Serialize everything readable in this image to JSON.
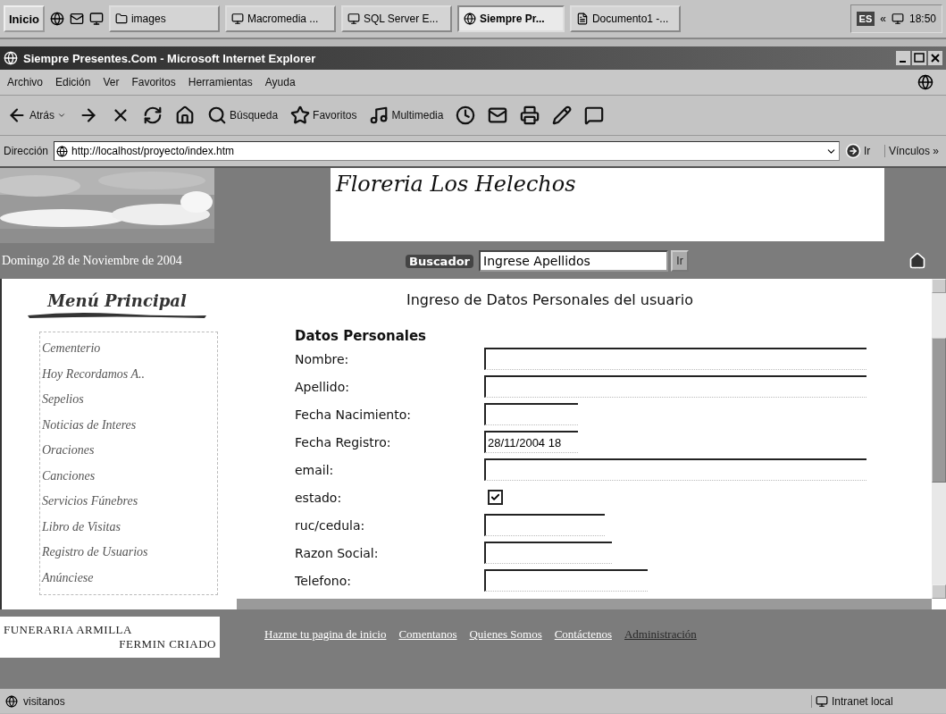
{
  "taskbar": {
    "start": "Inicio",
    "buttons": [
      {
        "label": "images",
        "kind": "folder",
        "selected": false
      },
      {
        "label": "Macromedia ...",
        "kind": "app",
        "selected": false
      },
      {
        "label": "SQL Server E...",
        "kind": "app",
        "selected": false
      },
      {
        "label": "Siempre Pr...",
        "kind": "browser",
        "selected": true
      },
      {
        "label": "Documento1 -...",
        "kind": "doc",
        "selected": false
      }
    ],
    "language": "ES",
    "tray_toggle": "«",
    "clock": "18:50"
  },
  "window": {
    "title": "Siempre Presentes.Com - Microsoft Internet Explorer"
  },
  "menu": [
    "Archivo",
    "Edición",
    "Ver",
    "Favoritos",
    "Herramientas",
    "Ayuda"
  ],
  "toolbar": [
    {
      "kind": "back",
      "label": "Atrás"
    },
    {
      "kind": "forward"
    },
    {
      "kind": "stop"
    },
    {
      "kind": "refresh"
    },
    {
      "kind": "home"
    },
    {
      "kind": "search",
      "label": "Búsqueda"
    },
    {
      "kind": "favorites",
      "label": "Favoritos"
    },
    {
      "kind": "media",
      "label": "Multimedia"
    },
    {
      "kind": "history"
    },
    {
      "kind": "mail"
    },
    {
      "kind": "print"
    },
    {
      "kind": "edit"
    },
    {
      "kind": "discuss"
    }
  ],
  "address": {
    "label": "Dirección",
    "url": "http://localhost/proyecto/index.htm",
    "go": "Ir",
    "links": "Vínculos »"
  },
  "banner": {
    "site_title": "Floreria Los Helechos",
    "date": "Domingo 28 de Noviembre de 2004",
    "search_label": "Buscador",
    "search_value": "Ingrese Apellidos",
    "search_button": "Ir"
  },
  "sidebar": {
    "heading": "Menú Principal",
    "items": [
      "Cementerio",
      "Hoy Recordamos A..",
      "Sepelios",
      "Noticias de Interes",
      "Oraciones",
      "Canciones",
      "Servicios Fúnebres",
      "Libro de Visitas",
      "Registro de Usuarios",
      "Anúnciese"
    ]
  },
  "form": {
    "title": "Ingreso de Datos Personales del usuario",
    "section": "Datos Personales",
    "fields": [
      {
        "label": "Nombre:",
        "kind": "text"
      },
      {
        "label": "Apellido:",
        "kind": "text"
      },
      {
        "label": "Fecha Nacimiento:",
        "kind": "text"
      },
      {
        "label": "Fecha Registro:",
        "kind": "text",
        "value": "28/11/2004 18"
      },
      {
        "label": "email:",
        "kind": "text"
      },
      {
        "label": "estado:",
        "kind": "checkbox",
        "checked": true
      },
      {
        "label": "ruc/cedula:",
        "kind": "text"
      },
      {
        "label": "Razon Social:",
        "kind": "text"
      },
      {
        "label": "Telefono:",
        "kind": "text"
      }
    ]
  },
  "footer": {
    "brand": [
      "FUNERARIA ARMILLA",
      "FERMIN CRIADO"
    ],
    "links": [
      {
        "label": "Hazme tu pagina de inicio",
        "visited": false
      },
      {
        "label": "Comentanos",
        "visited": false
      },
      {
        "label": "Quienes Somos",
        "visited": false
      },
      {
        "label": "Contáctenos",
        "visited": false
      },
      {
        "label": "Administración",
        "visited": true
      }
    ]
  },
  "status_bar": {
    "text": "visitanos",
    "zone": "Intranet local"
  }
}
